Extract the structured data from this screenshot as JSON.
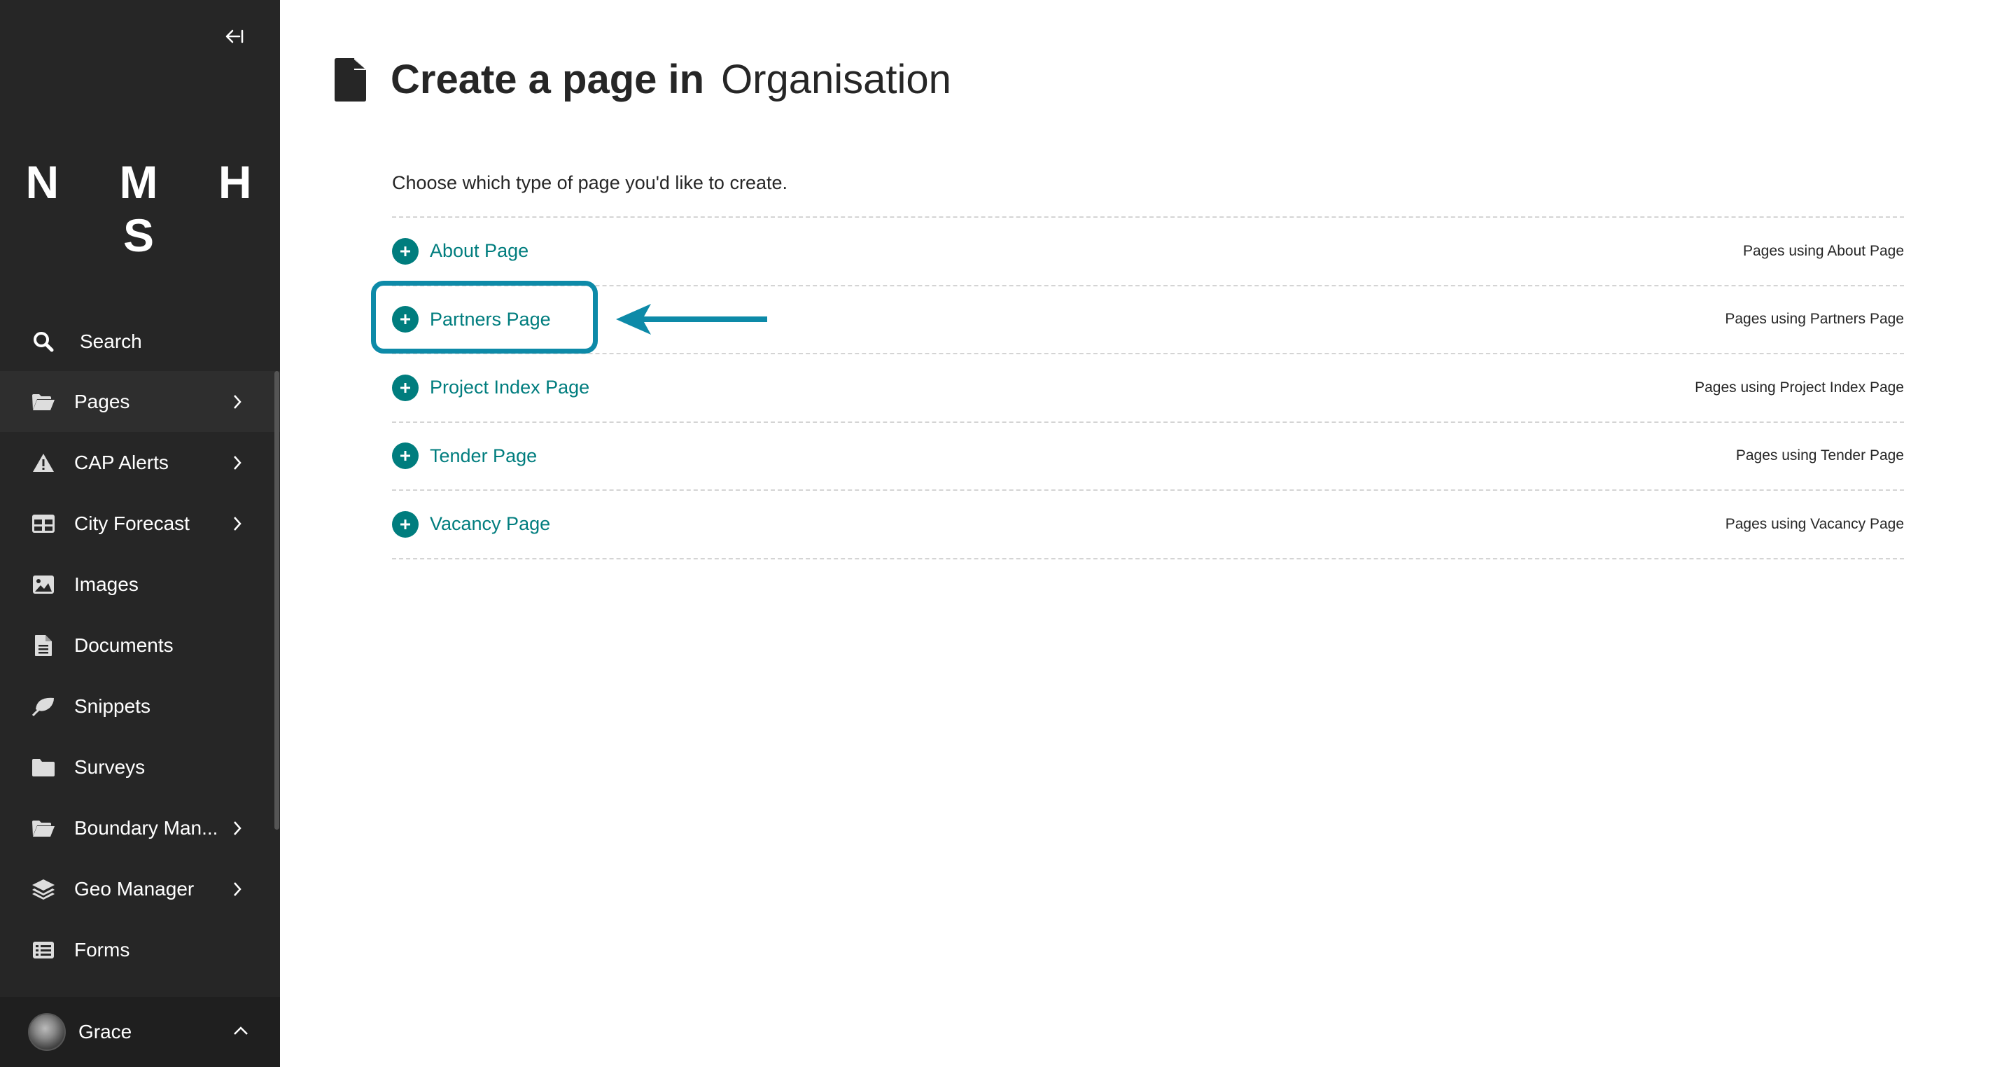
{
  "sidebar": {
    "logo": "N M H S",
    "search_label": "Search",
    "items": [
      {
        "label": "Pages",
        "has_children": true
      },
      {
        "label": "CAP Alerts",
        "has_children": true
      },
      {
        "label": "City Forecast",
        "has_children": true
      },
      {
        "label": "Images",
        "has_children": false
      },
      {
        "label": "Documents",
        "has_children": false
      },
      {
        "label": "Snippets",
        "has_children": false
      },
      {
        "label": "Surveys",
        "has_children": false
      },
      {
        "label": "Boundary Man...",
        "has_children": true
      },
      {
        "label": "Geo Manager",
        "has_children": true
      },
      {
        "label": "Forms",
        "has_children": false
      }
    ],
    "user": {
      "name": "Grace"
    }
  },
  "header": {
    "title_strong": "Create a page in",
    "title_parent": "Organisation"
  },
  "intro": "Choose which type of page you'd like to create.",
  "page_types": [
    {
      "label": "About Page",
      "usage_link": "Pages using About Page"
    },
    {
      "label": "Partners Page",
      "usage_link": "Pages using Partners Page",
      "highlighted": true
    },
    {
      "label": "Project Index Page",
      "usage_link": "Pages using Project Index Page"
    },
    {
      "label": "Tender Page",
      "usage_link": "Pages using Tender Page"
    },
    {
      "label": "Vacancy Page",
      "usage_link": "Pages using Vacancy Page"
    }
  ],
  "colors": {
    "sidebar_bg": "#262626",
    "accent_teal": "#007d7e",
    "annotation_blue": "#0d8aa8"
  }
}
